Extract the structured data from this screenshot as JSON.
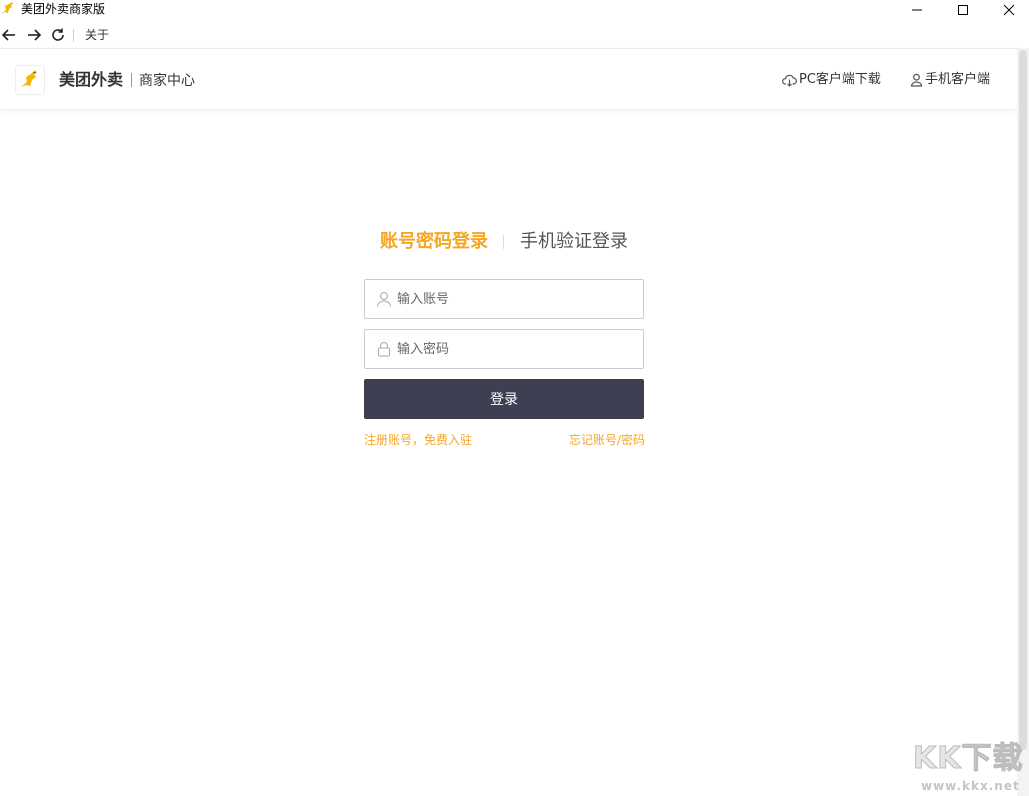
{
  "window": {
    "title": "美团外卖商家版",
    "icon": "meituan-kangaroo-icon"
  },
  "navbar": {
    "about_label": "关于"
  },
  "header": {
    "brand_name": "美团外卖",
    "brand_sub": "商家中心",
    "pc_download_label": "PC客户端下载",
    "mobile_client_label": "手机客户端"
  },
  "login": {
    "tabs": [
      {
        "label": "账号密码登录",
        "active": true
      },
      {
        "label": "手机验证登录",
        "active": false
      }
    ],
    "account_placeholder": "输入账号",
    "account_value": "",
    "password_placeholder": "输入密码",
    "password_value": "",
    "submit_label": "登录",
    "register_link": "注册账号，免费入驻",
    "forgot_link": "忘记账号/密码"
  },
  "watermark": {
    "big_text": "KK下载",
    "small_text": "www.kkx.net"
  },
  "colors": {
    "accent": "#f5a623",
    "button": "#3e3f52",
    "logo_yellow": "#f5b800"
  }
}
